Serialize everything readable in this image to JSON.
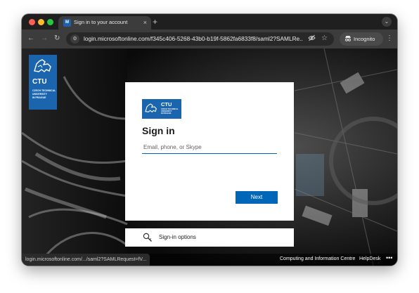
{
  "browser": {
    "tab": {
      "title": "Sign in to your account",
      "favicon": "ms-favicon",
      "close_glyph": "×"
    },
    "new_tab_glyph": "+",
    "tab_search_glyph": "⌄",
    "nav": {
      "back_glyph": "←",
      "forward_glyph": "→",
      "reload_glyph": "↻"
    },
    "url": "login.microsoftonline.com/f345c406-5268-43b0-b19f-5862fa6833f8/saml2?SAMLRe...",
    "incognito_label": "Incognito",
    "menu_glyph": "⋮"
  },
  "branding": {
    "logo_word": "CTU",
    "logo_lines": [
      "CZECH TECHNICAL",
      "UNIVERSITY",
      "IN PRAGUE"
    ],
    "color": "#1b65ae"
  },
  "signin": {
    "heading": "Sign in",
    "email_placeholder": "Email, phone, or Skype",
    "email_value": "",
    "next_label": "Next",
    "accent": "#0067b8"
  },
  "signin_options": {
    "icon": "key-search-icon",
    "label": "Sign-in options"
  },
  "footer": {
    "status_url": "login.microsoftonline.com/.../saml2?SAMLRequest=fV...",
    "links": [
      "Computing and Information Centre",
      "HelpDesk"
    ],
    "more_glyph": "•••"
  }
}
